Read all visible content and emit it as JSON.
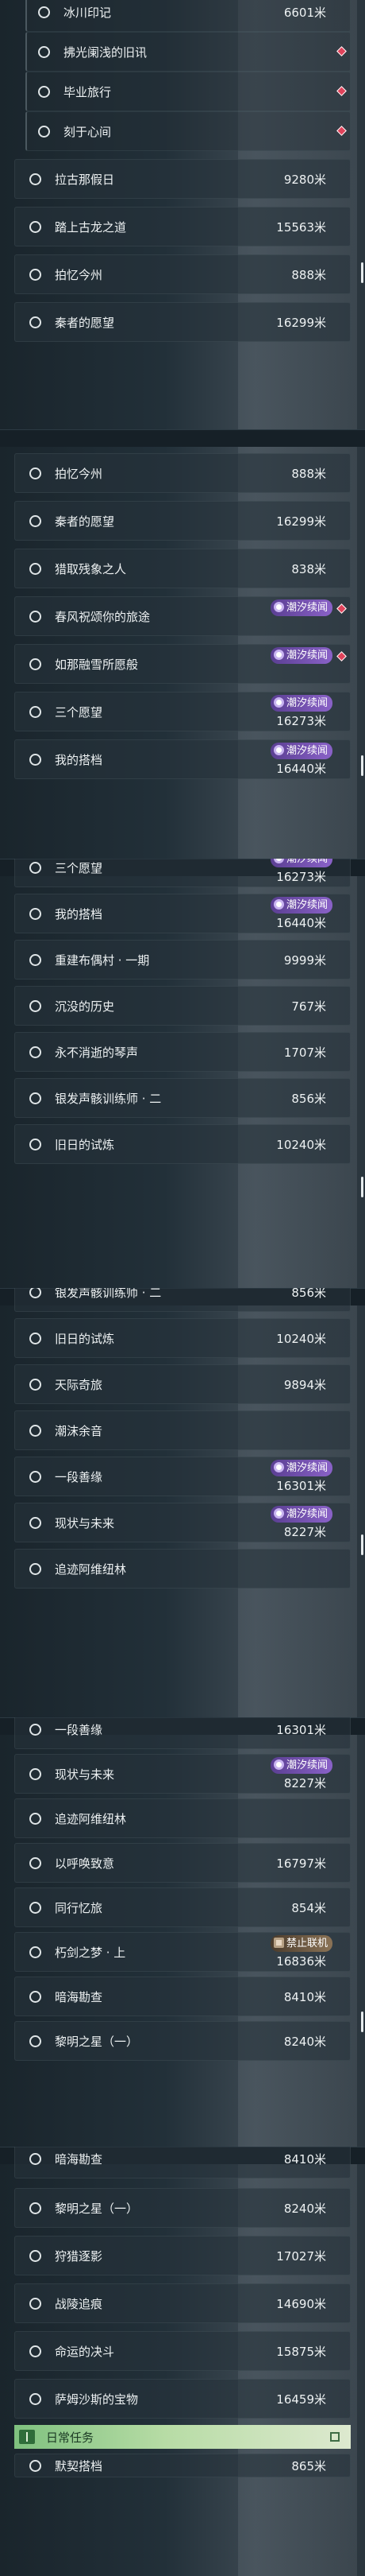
{
  "badges": {
    "event": "潮汐续闻",
    "ban": "禁止联机"
  },
  "daily_section": {
    "label": "日常任务"
  },
  "segments": [
    {
      "items": [
        {
          "label": "冰川印记",
          "distance": "6601米",
          "sub": true
        },
        {
          "label": "拂光阑浅的旧讯",
          "distance": "",
          "sub": true,
          "diamond": true
        },
        {
          "label": "毕业旅行",
          "distance": "",
          "sub": true,
          "diamond": true
        },
        {
          "label": "刻于心间",
          "distance": "",
          "sub": true,
          "diamond": true
        },
        {
          "label": "拉古那假日",
          "distance": "9280米"
        },
        {
          "label": "踏上古龙之道",
          "distance": "15563米"
        },
        {
          "label": "拍忆今州",
          "distance": "888米"
        },
        {
          "label": "秦者的愿望",
          "distance": "16299米"
        }
      ]
    },
    {
      "items": [
        {
          "label": "拍忆今州",
          "distance": "888米"
        },
        {
          "label": "秦者的愿望",
          "distance": "16299米"
        },
        {
          "label": "猎取残象之人",
          "distance": "838米"
        },
        {
          "label": "春风祝颂你的旅途",
          "distance": "",
          "badge": "event",
          "diamond": true
        },
        {
          "label": "如那融雪所愿般",
          "distance": "",
          "badge": "event",
          "diamond": true
        },
        {
          "label": "三个愿望",
          "distance": "16273米",
          "badge": "event"
        },
        {
          "label": "我的搭档",
          "distance": "16440米",
          "badge": "event"
        }
      ]
    },
    {
      "items": [
        {
          "label": "三个愿望",
          "distance": "16273米",
          "badge": "event"
        },
        {
          "label": "我的搭档",
          "distance": "16440米",
          "badge": "event"
        },
        {
          "label": "重建布偶村 · 一期",
          "distance": "9999米"
        },
        {
          "label": "沉没的历史",
          "distance": "767米"
        },
        {
          "label": "永不消逝的琴声",
          "distance": "1707米"
        },
        {
          "label": "银发声骸训练师 · 二",
          "distance": "856米"
        },
        {
          "label": "旧日的试炼",
          "distance": "10240米"
        }
      ]
    },
    {
      "items": [
        {
          "label": "银发声骸训练师 · 二",
          "distance": "856米"
        },
        {
          "label": "旧日的试炼",
          "distance": "10240米"
        },
        {
          "label": "天际奇旅",
          "distance": "9894米"
        },
        {
          "label": "潮沫余音",
          "distance": ""
        },
        {
          "label": "一段善缘",
          "distance": "16301米",
          "badge": "event"
        },
        {
          "label": "现状与未来",
          "distance": "8227米",
          "badge": "event"
        },
        {
          "label": "追迹阿维纽林",
          "distance": ""
        }
      ]
    },
    {
      "items": [
        {
          "label": "一段善缘",
          "distance": "16301米"
        },
        {
          "label": "现状与未来",
          "distance": "8227米",
          "badge": "event"
        },
        {
          "label": "追迹阿维纽林",
          "distance": ""
        },
        {
          "label": "以呼唤致意",
          "distance": "16797米"
        },
        {
          "label": "同行忆旅",
          "distance": "854米"
        },
        {
          "label": "朽剑之梦 · 上",
          "distance": "16836米",
          "badge": "ban"
        },
        {
          "label": "暗海勘查",
          "distance": "8410米"
        },
        {
          "label": "黎明之星（一）",
          "distance": "8240米"
        }
      ]
    },
    {
      "items": [
        {
          "label": "暗海勘查",
          "distance": "8410米"
        },
        {
          "label": "黎明之星（一）",
          "distance": "8240米"
        },
        {
          "label": "狩猎逐影",
          "distance": "17027米"
        },
        {
          "label": "战陵追痕",
          "distance": "14690米"
        },
        {
          "label": "命运的决斗",
          "distance": "15875米"
        },
        {
          "label": "萨姆沙斯的宝物",
          "distance": "16459米"
        }
      ],
      "tail": {
        "label": "默契搭档",
        "distance": "865米"
      }
    }
  ]
}
